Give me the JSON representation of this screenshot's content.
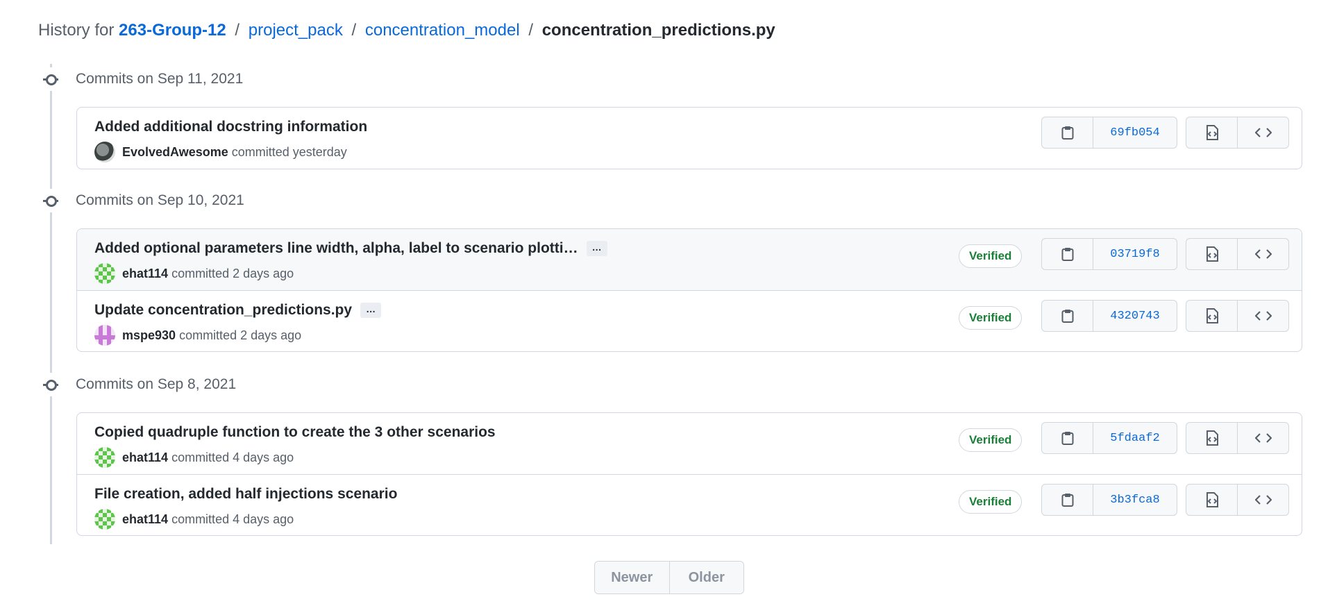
{
  "breadcrumb": {
    "prefix": "History for",
    "repo": "263-Group-12",
    "path": [
      "project_pack",
      "concentration_model"
    ],
    "file": "concentration_predictions.py",
    "separator": "/"
  },
  "groups": [
    {
      "label": "Commits on Sep 11, 2021",
      "commits": [
        {
          "message": "Added additional docstring information",
          "has_ellipsis": false,
          "author": "EvolvedAwesome",
          "time": "committed yesterday",
          "verified": false,
          "sha": "69fb054",
          "avatar": "avatar-evolvedawesome"
        }
      ]
    },
    {
      "label": "Commits on Sep 10, 2021",
      "commits": [
        {
          "message": "Added optional parameters line width, alpha, label to scenario plotti…",
          "has_ellipsis": true,
          "author": "ehat114",
          "time": "committed 2 days ago",
          "verified": true,
          "sha": "03719f8",
          "avatar": "avatar-ehat114"
        },
        {
          "message": "Update concentration_predictions.py",
          "has_ellipsis": true,
          "author": "mspe930",
          "time": "committed 2 days ago",
          "verified": true,
          "sha": "4320743",
          "avatar": "avatar-mspe930"
        }
      ]
    },
    {
      "label": "Commits on Sep 8, 2021",
      "commits": [
        {
          "message": "Copied quadruple function to create the 3 other scenarios",
          "has_ellipsis": false,
          "author": "ehat114",
          "time": "committed 4 days ago",
          "verified": true,
          "sha": "5fdaaf2",
          "avatar": "avatar-ehat114"
        },
        {
          "message": "File creation, added half injections scenario",
          "has_ellipsis": false,
          "author": "ehat114",
          "time": "committed 4 days ago",
          "verified": true,
          "sha": "3b3fca8",
          "avatar": "avatar-ehat114"
        }
      ]
    }
  ],
  "labels": {
    "verified": "Verified",
    "ellipsis": "…"
  },
  "icons": {
    "copy": "clipboard-icon",
    "browse": "file-code-icon",
    "code": "code-icon",
    "commit": "git-commit-icon"
  },
  "pagination": {
    "newer": "Newer",
    "older": "Older"
  },
  "colors": {
    "link": "#0969da",
    "verified": "#1a7f37",
    "border": "#d0d7de"
  }
}
